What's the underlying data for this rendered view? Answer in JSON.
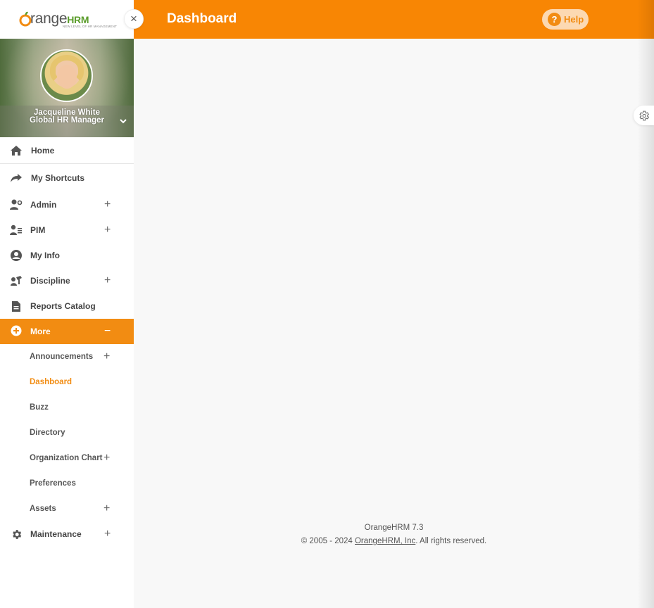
{
  "logo": {
    "brand_o": "O",
    "brand_range": "range",
    "brand_hrm": "HRM",
    "tagline": "NEW LEVEL OF HR MANAGEMENT"
  },
  "close_label": "×",
  "profile": {
    "name": "Jacqueline White",
    "job_title": "Global HR Manager"
  },
  "menu": {
    "home": "Home",
    "shortcuts": "My Shortcuts",
    "admin": "Admin",
    "pim": "PIM",
    "my_info": "My Info",
    "discipline": "Discipline",
    "reports": "Reports Catalog",
    "more": "More",
    "sub": {
      "announcements": "Announcements",
      "dashboard": "Dashboard",
      "buzz": "Buzz",
      "directory": "Directory",
      "org_chart": "Organization Chart",
      "preferences": "Preferences",
      "assets": "Assets"
    },
    "maintenance": "Maintenance",
    "plus": "+",
    "minus": "−"
  },
  "header": {
    "title": "Dashboard",
    "help_label": "Help",
    "help_icon": "?"
  },
  "footer": {
    "version": "OrangeHRM 7.3",
    "copyright_prefix": "© 2005 - 2024 ",
    "company_link": "OrangeHRM, Inc",
    "copyright_suffix": ". All rights reserved."
  },
  "colors": {
    "accent": "#f88604",
    "sidebar_bg": "#ffffff",
    "content_bg": "#f8f8f8"
  },
  "icons": [
    "home-icon",
    "share-icon",
    "user-cog-icon",
    "id-list-icon",
    "user-circle-icon",
    "discipline-icon",
    "report-icon",
    "plus-circle-icon",
    "gear-icon",
    "chevron-down-icon",
    "close-icon",
    "help-icon",
    "settings-icon"
  ]
}
